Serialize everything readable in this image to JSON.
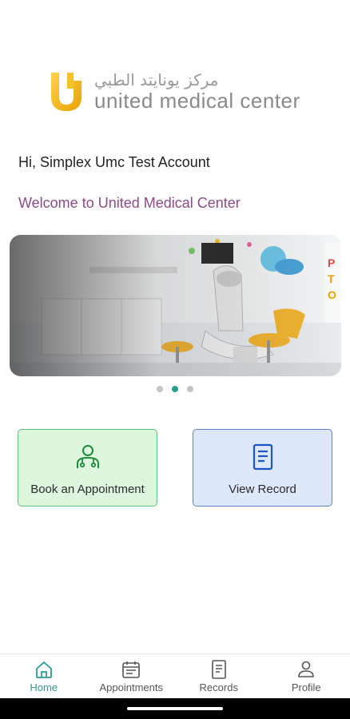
{
  "brand": {
    "arabic_name": "مركز يونايتد الطبي",
    "english_name": "united medical center",
    "accent_color": "#f4b400"
  },
  "greeting": "Hi, Simplex Umc Test Account",
  "welcome": "Welcome to United Medical Center",
  "carousel": {
    "slide_count": 3,
    "active_index": 1
  },
  "actions": {
    "book": {
      "label": "Book an Appointment",
      "icon": "doctor-icon",
      "bg": "#dcf7de",
      "border": "#64c07a"
    },
    "view": {
      "label": "View Record",
      "icon": "document-icon",
      "bg": "#dde8fb",
      "border": "#5e84c6"
    }
  },
  "nav": {
    "active_color": "#2a9d8f",
    "items": [
      {
        "label": "Home",
        "icon": "home-icon"
      },
      {
        "label": "Appointments",
        "icon": "calendar-icon"
      },
      {
        "label": "Records",
        "icon": "records-icon"
      },
      {
        "label": "Profile",
        "icon": "user-icon"
      }
    ]
  }
}
